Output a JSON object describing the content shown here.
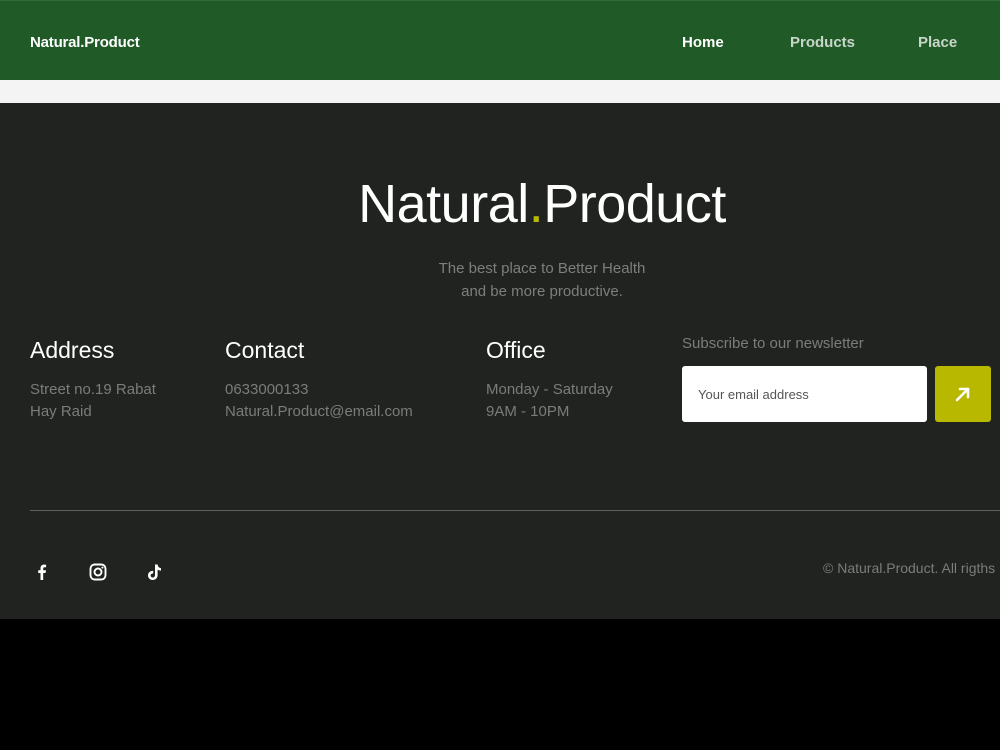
{
  "nav": {
    "brand": "Natural.Product",
    "links": [
      {
        "label": "Home",
        "active": true
      },
      {
        "label": "Products",
        "active": false
      },
      {
        "label": "Place",
        "active": false
      }
    ]
  },
  "footer": {
    "logo_left": "Natural",
    "logo_dot": ".",
    "logo_right": "Product",
    "tagline_line1": "The best place to Better Health",
    "tagline_line2": "and be more productive.",
    "address": {
      "title": "Address",
      "line1": "Street no.19 Rabat",
      "line2": "Hay Raid"
    },
    "contact": {
      "title": "Contact",
      "phone": "0633000133",
      "email": "Natural.Product@email.com"
    },
    "office": {
      "title": "Office",
      "days": "Monday - Saturday",
      "hours": "9AM - 10PM"
    },
    "newsletter": {
      "label": "Subscribe to our newsletter",
      "placeholder": "Your email address",
      "button_icon": "arrow-up-right-icon"
    },
    "social_icons": [
      "facebook-icon",
      "instagram-icon",
      "tiktok-icon"
    ],
    "copyright": "© Natural.Product. All rigths"
  },
  "colors": {
    "nav_bg": "#1f5a27",
    "footer_bg": "#20231f",
    "accent": "#b9b800",
    "muted_text": "#7a7d79"
  }
}
